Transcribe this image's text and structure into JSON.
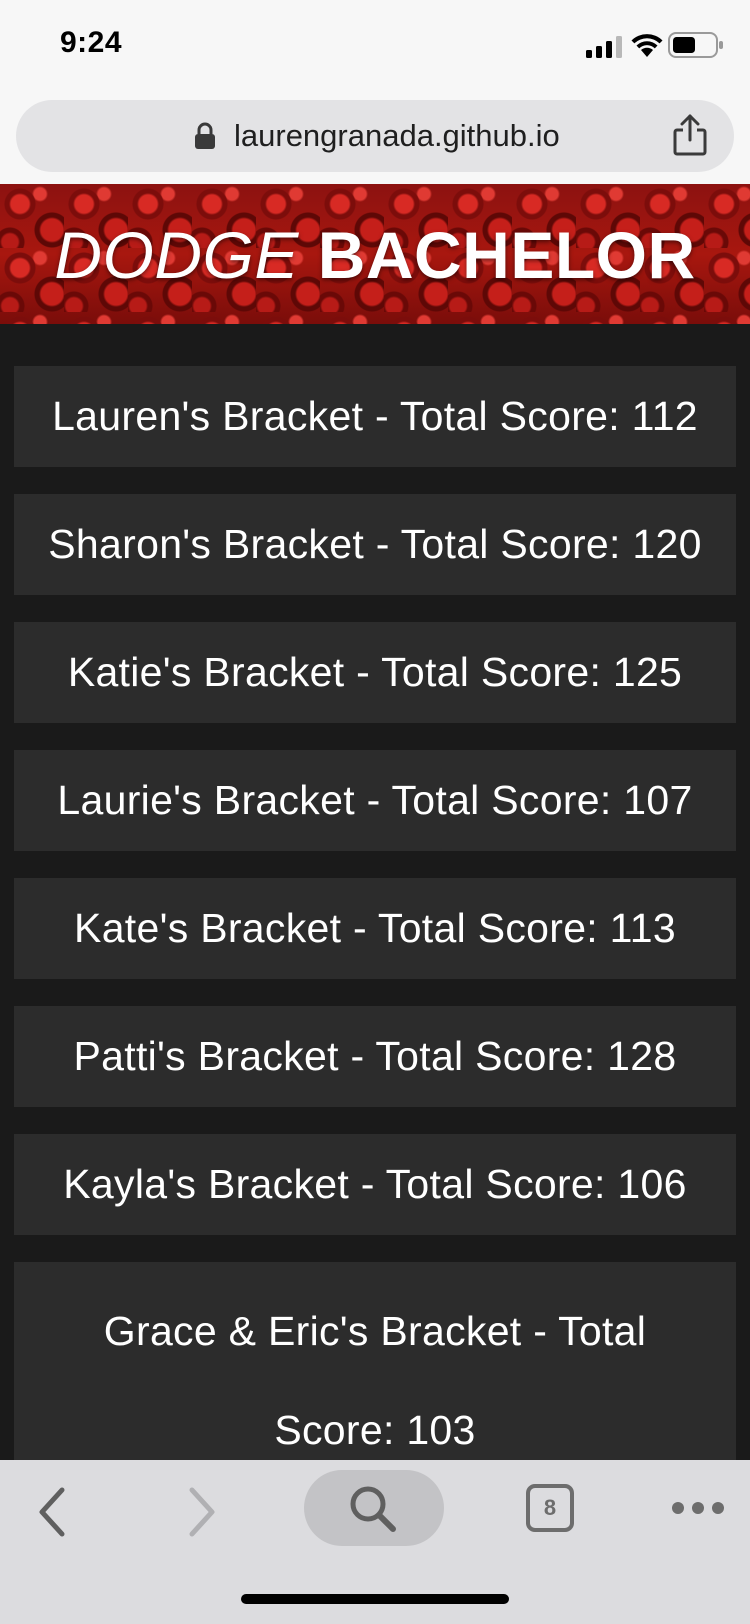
{
  "status_bar": {
    "time": "9:24"
  },
  "browser": {
    "url": "laurengranada.github.io",
    "tab_count": "8"
  },
  "header": {
    "title_light": "DODGE",
    "title_bold": "BACHELOR"
  },
  "brackets": [
    {
      "label": "Lauren's Bracket - Total Score: 112"
    },
    {
      "label": "Sharon's Bracket - Total Score: 120"
    },
    {
      "label": "Katie's Bracket - Total Score: 125"
    },
    {
      "label": "Laurie's Bracket - Total Score: 107"
    },
    {
      "label": "Kate's Bracket - Total Score: 113"
    },
    {
      "label": "Patti's Bracket - Total Score: 128"
    },
    {
      "label": "Kayla's Bracket - Total Score: 106"
    },
    {
      "label": "Grace & Eric's Bracket - Total Score: 103"
    }
  ],
  "icons": {
    "status": [
      "signal-icon",
      "wifi-icon",
      "battery-icon"
    ],
    "url_bar": [
      "lock-icon",
      "share-icon"
    ],
    "toolbar": [
      "back-icon",
      "forward-icon",
      "search-icon",
      "tabs-icon",
      "more-icon"
    ]
  },
  "colors": {
    "page_background": "#1a1a1a",
    "item_background": "#2c2c2c",
    "banner_red": "#a8170f",
    "text": "#ffffff"
  }
}
